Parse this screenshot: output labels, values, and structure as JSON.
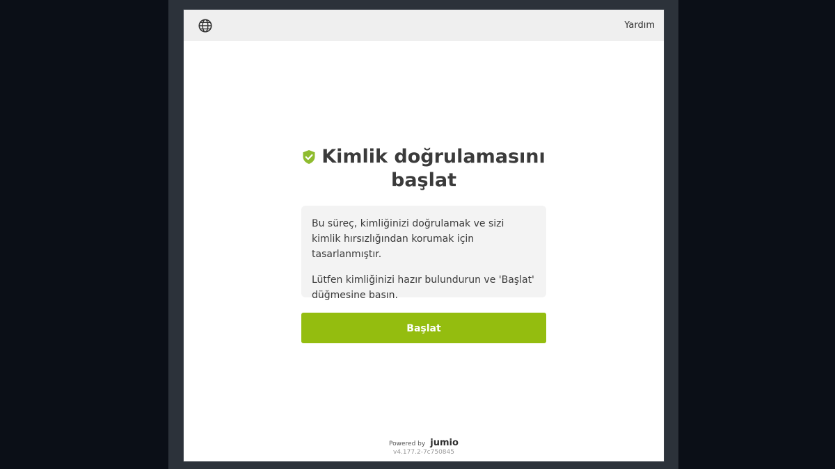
{
  "header": {
    "language_icon": "globe-icon",
    "help_label": "Yardım"
  },
  "main": {
    "title_icon": "shield-check-icon",
    "title": "Kimlik doğrulamasını başlat",
    "info_paragraph_1": "Bu süreç, kimliğinizi doğrulamak ve sizi kimlik hırsızlığından korumak için tasarlanmıştır.",
    "info_paragraph_2": "Lütfen kimliğinizi hazır bulundurun ve 'Başlat' düğmesine basın.",
    "start_button_label": "Başlat"
  },
  "footer": {
    "powered_by": "Powered by",
    "brand": "jumio",
    "version": "v4.177.2-7c750845"
  },
  "colors": {
    "accent": "#94bd0f",
    "shield": "#8fbc2f",
    "topbar": "#efefef",
    "info_box": "#f3f3f3",
    "backdrop": "#0b0f17",
    "frame": "#2c323a"
  }
}
